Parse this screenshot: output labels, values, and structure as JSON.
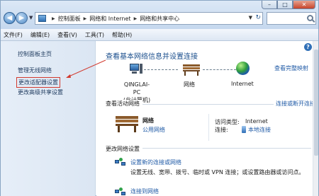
{
  "window": {
    "controls": {
      "minimize": "–",
      "maximize": "□",
      "close": "✕"
    }
  },
  "address": {
    "crumbs": [
      "控制面板",
      "网络和 Internet",
      "网络和共享中心"
    ]
  },
  "menu": [
    "文件(F)",
    "编辑(E)",
    "查看(V)",
    "工具(T)",
    "帮助(H)"
  ],
  "left_pane": {
    "home": "控制面板主页",
    "links": [
      "管理无线网络",
      "更改适配器设置",
      "更改高级共享设置"
    ]
  },
  "main": {
    "title": "查看基本网络信息并设置连接",
    "full_map": "查看完整映射",
    "map": {
      "pc_name": "QINGLAI-PC",
      "pc_sub": "(此计算机)",
      "network": "网络",
      "internet": "Internet"
    },
    "active_section": {
      "label": "查看活动网络",
      "connect_link": "连接或断开连接",
      "network_name": "网络",
      "network_type": "公用网络",
      "access_type_label": "访问类型:",
      "access_type_value": "Internet",
      "connections_label": "连接:",
      "connections_value": "本地连接"
    },
    "change_section": {
      "label": "更改网络设置",
      "task1_link": "设置新的连接或网络",
      "task1_desc_1": "设置无线、宽带、拨号、临时或 VPN 连接；或设置路由器或访问点。",
      "task2_link": "连接到网络"
    }
  },
  "help": "?",
  "colors": {
    "link": "#1f5aa6",
    "annotation": "#d23a2f",
    "title": "#1b4f8d"
  },
  "icons": [
    "back-arrow-icon",
    "forward-arrow-icon",
    "search-icon",
    "help-icon",
    "computer-icon",
    "bench-network-icon",
    "globe-internet-icon",
    "connection-icon",
    "task-network-icon"
  ]
}
